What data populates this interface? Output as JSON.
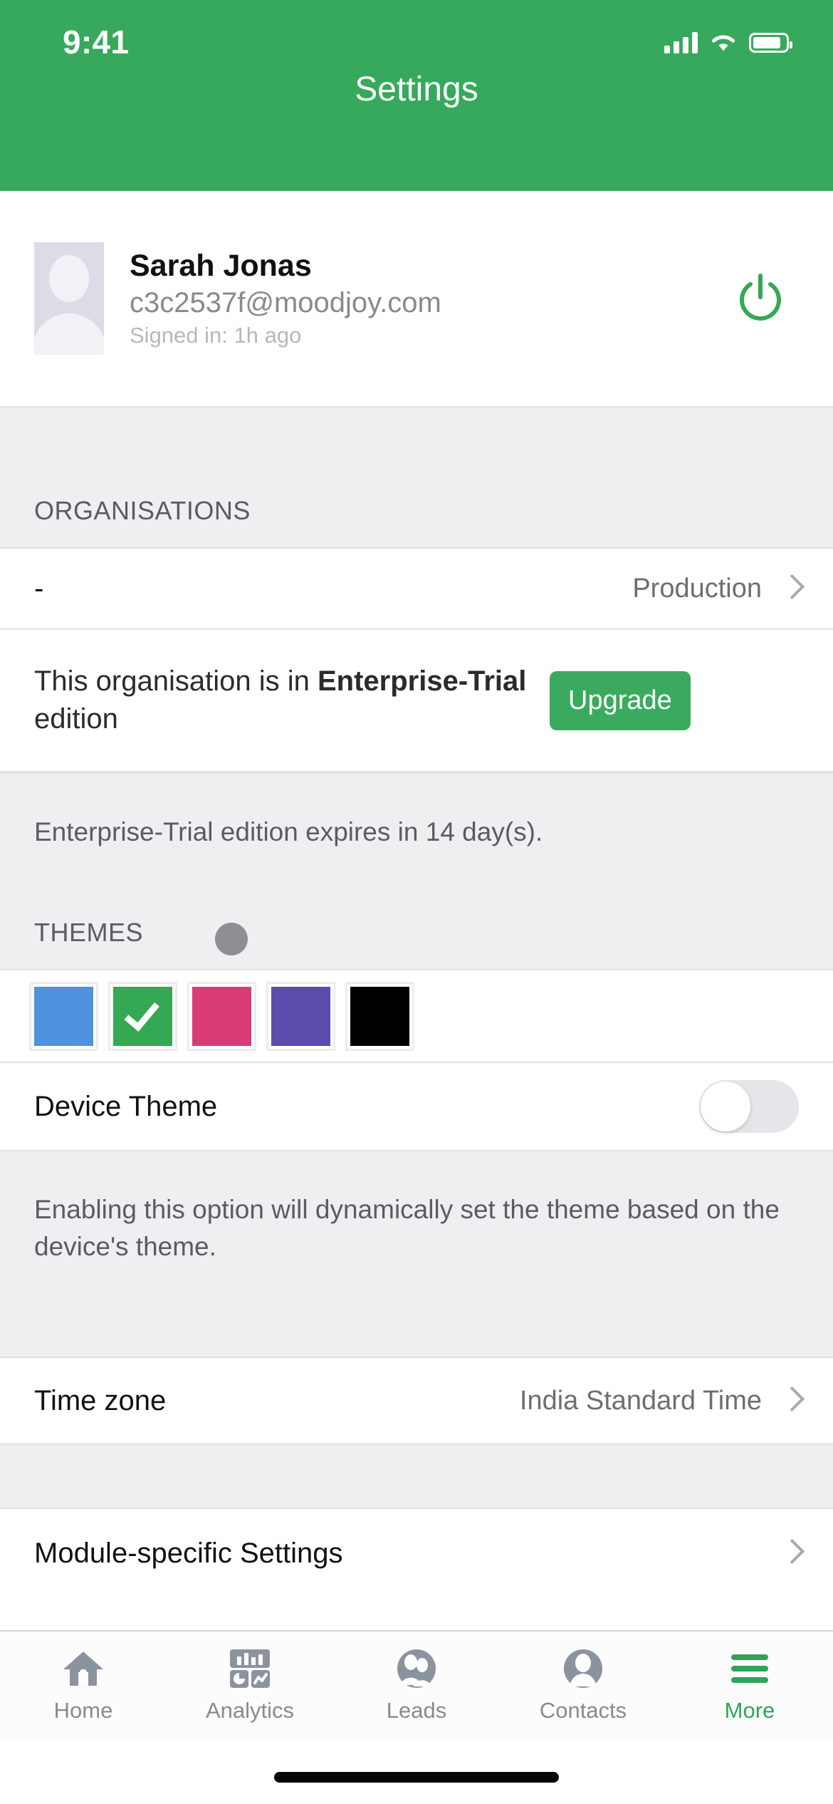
{
  "status_bar": {
    "time": "9:41",
    "signal_icon": "cellular-signal-icon",
    "wifi_icon": "wifi-icon",
    "battery_icon": "battery-icon"
  },
  "header": {
    "title": "Settings",
    "background_color": "#37A95C"
  },
  "profile": {
    "avatar_icon": "user-avatar-placeholder",
    "name": "Sarah Jonas",
    "email": "c3c2537f@moodjoy.com",
    "signed_in": "Signed in: 1h ago",
    "logout_icon": "power-icon",
    "logout_color": "#34A853"
  },
  "organisations": {
    "section_title": "ORGANISATIONS",
    "org_row": {
      "label": "-",
      "value": "Production",
      "chevron_icon": "chevron-right-icon"
    },
    "edition_row": {
      "text_before": "This organisation is in ",
      "edition_name": "Enterprise-Trial",
      "text_after": " edition",
      "upgrade_label": "Upgrade",
      "upgrade_color": "#3AAB5E"
    },
    "expiry_note": "Enterprise-Trial edition expires in 14 day(s)."
  },
  "themes": {
    "section_title": "THEMES",
    "swatches": [
      {
        "name": "blue",
        "color": "#4F92DD",
        "selected": false
      },
      {
        "name": "green",
        "color": "#34A853",
        "selected": true
      },
      {
        "name": "pink",
        "color": "#D93B77",
        "selected": false
      },
      {
        "name": "purple",
        "color": "#5B4DAE",
        "selected": false
      },
      {
        "name": "black",
        "color": "#000000",
        "selected": false
      }
    ],
    "device_theme": {
      "label": "Device Theme",
      "enabled": false
    },
    "device_theme_note": "Enabling this option will dynamically set the theme based on the device's theme."
  },
  "time_zone_row": {
    "label": "Time zone",
    "value": "India Standard Time",
    "chevron_icon": "chevron-right-icon"
  },
  "module_settings_row": {
    "label": "Module-specific Settings",
    "chevron_icon": "chevron-right-icon"
  },
  "tab_bar": {
    "active_color": "#2FA35A",
    "inactive_color": "#8A8A8E",
    "tabs": [
      {
        "label": "Home",
        "icon": "home-icon",
        "active": false
      },
      {
        "label": "Analytics",
        "icon": "analytics-icon",
        "active": false
      },
      {
        "label": "Leads",
        "icon": "leads-icon",
        "active": false
      },
      {
        "label": "Contacts",
        "icon": "contacts-icon",
        "active": false
      },
      {
        "label": "More",
        "icon": "hamburger-menu-icon",
        "active": true
      }
    ]
  }
}
